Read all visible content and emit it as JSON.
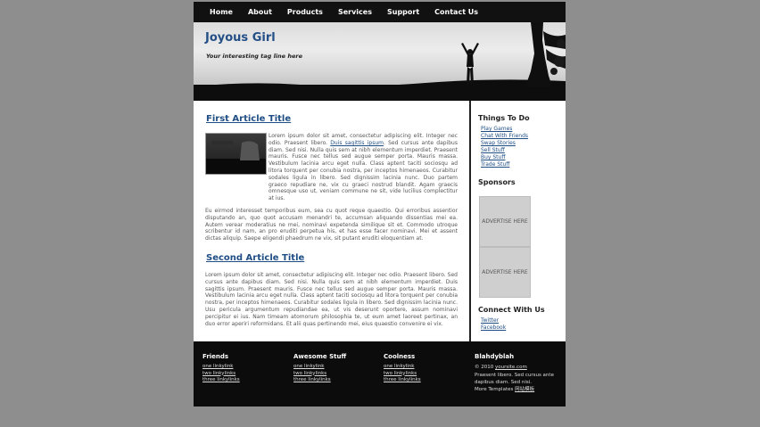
{
  "nav": {
    "items": [
      "Home",
      "About",
      "Products",
      "Services",
      "Support",
      "Contact Us"
    ]
  },
  "header": {
    "title": "Joyous Girl",
    "tagline": "Your interesting tag line here"
  },
  "articles": [
    {
      "title": "First Article Title",
      "p1_before_link": "Lorem ipsum dolor sit amet, consectetur adipiscing elit. Integer nec odio. Praesent libero.",
      "p1_link": "Duis sagittis ipsum",
      "p1_after_link": ". Sed cursus ante dapibus diam. Sed nisi. Nulla quis sem at nibh elementum imperdiet. Praesent mauris. Fusce nec tellus sed augue semper porta. Mauris massa. Vestibulum lacinia arcu eget nulla. Class aptent taciti sociosqu ad litora torquent per conubia nostra, per inceptos himenaeos. Curabitur sodales ligula in libero. Sed dignissim lacinia nunc. Duo partem graeco repudiare ne, vix cu graeci nostrud blandit. Agam graecis omnesque uso ut, veniam commune ne sit, vide lucilius complectitur at ius.",
      "p2": "Eu eirmod interesset temporibus eum, sea cu quot reque quaestio. Qui erroribus assentior disputando an, quo quot accusam menandri te, accumsan aliquando dissentias mei ea. Autem verear moderatius ne mei, nominavi expetenda similique sit et. Commodo utroque scribentur id nam, an pro eruditi perpetua his, et has esse facer nominavi. Mei et assent dictas aliquip. Saepe eligendi phaedrum ne vix, sit putant eruditi eloquentiam at."
    },
    {
      "title": "Second Article Title",
      "p1": "Lorem ipsum dolor sit amet, consectetur adipiscing elit. Integer nec odio. Praesent libero. Sed cursus ante dapibus diam. Sed nisi. Nulla quis sem at nibh elementum imperdiet. Duis sagittis ipsum. Praesent mauris. Fusce nec tellus sed augue semper porta. Mauris massa. Vestibulum lacinia arcu eget nulla. Class aptent taciti sociosqu ad litora torquent per conubia nostra, per inceptos himenaeos. Curabitur sodales ligula in libero. Sed dignissim lacinia nunc. Usu pericula argumentum repudiandae ea, ut vis deserunt oportere, assum nominavi percipitur ei ius. Nam timeam atomorum philosophia te, ut eum amet laoreet pertinax, an duo error aperiri reformidans. Et alii quas pertinendo mei, eius quaestio convenire ei vix."
    }
  ],
  "sidebar": {
    "things_title": "Things To Do",
    "things": [
      "Play Games",
      "Chat With Friends",
      "Swap Stories",
      "Sell Stuff",
      "Buy Stuff",
      "Trade Stuff"
    ],
    "sponsors_title": "Sponsors",
    "ads": [
      "ADVERTISE HERE",
      "ADVERTISE HERE"
    ],
    "connect_title": "Connect With Us",
    "connect": [
      "Twitter",
      "Facebook"
    ]
  },
  "footer": {
    "cols": [
      {
        "title": "Friends",
        "links": [
          "one linkylink",
          "two linkylinks",
          "three linkylinks"
        ]
      },
      {
        "title": "Awesome Stuff",
        "links": [
          "one linkylink",
          "two linkylinks",
          "three linkylinks"
        ]
      },
      {
        "title": "Coolness",
        "links": [
          "one linkylink",
          "two linkylinks",
          "three linkylinks"
        ]
      }
    ],
    "blah": {
      "title": "Blahdyblah",
      "copy": "© 2010",
      "site": "yoursite.com",
      "text": "Praesent libero. Sed cursus ante dapibus diam. Sed nisi.",
      "more": "More Templates",
      "more_link": "网站模板"
    }
  }
}
